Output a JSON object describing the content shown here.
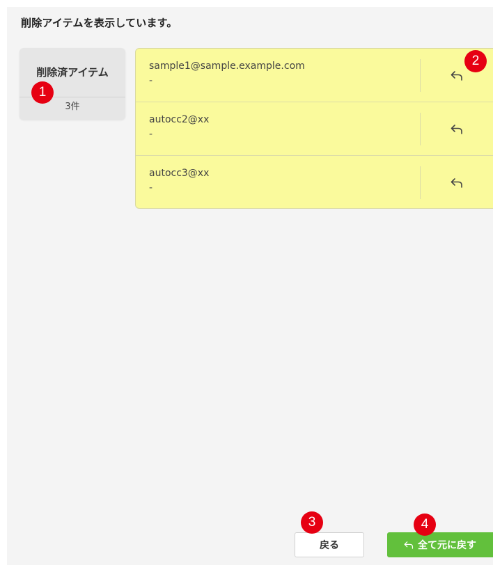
{
  "header": {
    "message": "削除アイテムを表示しています。"
  },
  "summary": {
    "title": "削除済アイテム",
    "count": "3件"
  },
  "items": [
    {
      "email": "sample1@sample.example.com",
      "sub": "-",
      "action_icon": "undo-icon"
    },
    {
      "email": "autocc2@xx",
      "sub": "-",
      "action_icon": "undo-icon"
    },
    {
      "email": "autocc3@xx",
      "sub": "-",
      "action_icon": "undo-icon"
    }
  ],
  "footer": {
    "back_label": "戻る",
    "restore_all_label": "全て元に戻す",
    "restore_all_icon": "undo-icon"
  },
  "annotations": [
    "1",
    "2",
    "3",
    "4"
  ],
  "colors": {
    "panel_bg": "#f4f4f4",
    "list_bg": "#fafa9c",
    "primary_button": "#62c03c",
    "annotation_badge": "#e60012"
  }
}
